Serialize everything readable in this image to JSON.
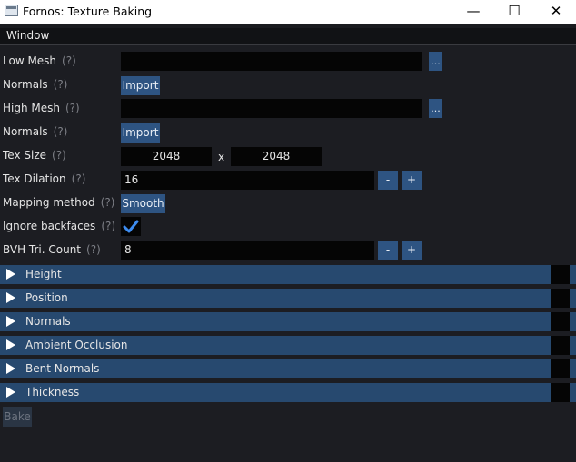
{
  "window": {
    "title": "Fornos: Texture Baking",
    "minimize_glyph": "—",
    "maximize_glyph": "☐",
    "close_glyph": "✕"
  },
  "menu": {
    "window_label": "Window"
  },
  "help_marker": "(?)",
  "form": {
    "low_mesh": {
      "label": "Low Mesh",
      "path_value": "",
      "browse_label": "..."
    },
    "low_normals": {
      "label": "Normals",
      "import_label": "Import"
    },
    "high_mesh": {
      "label": "High Mesh",
      "path_value": "",
      "browse_label": "..."
    },
    "high_normals": {
      "label": "Normals",
      "import_label": "Import"
    },
    "tex_size": {
      "label": "Tex Size",
      "width": "2048",
      "separator": "x",
      "height": "2048"
    },
    "tex_dilation": {
      "label": "Tex Dilation",
      "value": "16",
      "minus": "-",
      "plus": "+"
    },
    "mapping_method": {
      "label": "Mapping method",
      "value": "Smooth"
    },
    "ignore_backfaces": {
      "label": "Ignore backfaces",
      "checked": true,
      "check_color": "#3d8cf0"
    },
    "bvh_tri_count": {
      "label": "BVH Tri. Count",
      "value": "8",
      "minus": "-",
      "plus": "+"
    }
  },
  "sections": [
    {
      "label": "Height"
    },
    {
      "label": "Position"
    },
    {
      "label": "Normals"
    },
    {
      "label": "Ambient Occlusion"
    },
    {
      "label": "Bent Normals"
    },
    {
      "label": "Thickness"
    }
  ],
  "bake_label": "Bake",
  "colors": {
    "accent": "#2e5482",
    "section_header": "#27496f",
    "background": "#1c1d22",
    "field": "#050505"
  }
}
